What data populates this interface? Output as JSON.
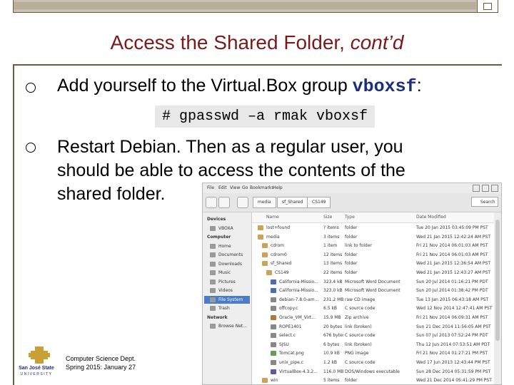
{
  "slide": {
    "title_main": "Access the Shared Folder, ",
    "title_italic": "cont’d",
    "bullet1_text": "Add yourself to the Virtual.Box group ",
    "bullet1_code": "vboxsf",
    "bullet1_colon": ":",
    "command": "# gpasswd –a rmak vboxsf",
    "bullet2_text": "Restart Debian. Then as a regular user, you should be able to access the contents of the shared folder.",
    "footer_line1": "Computer Science Dept.",
    "footer_line2": "Spring 2015: January 27",
    "logo_text": "San José State",
    "logo_sub": "UNIVERSITY"
  },
  "file_manager": {
    "menu": [
      "File",
      "Edit",
      "View",
      "Go",
      "Bookmarks",
      "Help"
    ],
    "breadcrumb": [
      "media",
      "sf_Shared",
      "CS149"
    ],
    "search_label": "Search",
    "columns": {
      "name": "Name",
      "size": "Size",
      "type": "Type",
      "modified": "Date Modified"
    },
    "sidebar": [
      {
        "kind": "head",
        "label": "Devices"
      },
      {
        "kind": "item",
        "label": "VBOXA"
      },
      {
        "kind": "head",
        "label": "Computer"
      },
      {
        "kind": "item",
        "label": "Home"
      },
      {
        "kind": "item",
        "label": "Documents"
      },
      {
        "kind": "item",
        "label": "Downloads"
      },
      {
        "kind": "item",
        "label": "Music"
      },
      {
        "kind": "item",
        "label": "Pictures"
      },
      {
        "kind": "item",
        "label": "Videos"
      },
      {
        "kind": "item",
        "label": "File System",
        "selected": true
      },
      {
        "kind": "item",
        "label": "Trash"
      },
      {
        "kind": "head",
        "label": "Network"
      },
      {
        "kind": "item",
        "label": "Browse Net..."
      }
    ],
    "rows": [
      {
        "name": "lost+found",
        "size": "? items",
        "type": "folder",
        "modified": "Tue 20 Jan 2015 03:45:09 PM PST",
        "color": "#c9a35a",
        "indent": 0
      },
      {
        "name": "media",
        "size": "3 items",
        "type": "folder",
        "modified": "Wed 21 Jan 2015 12:42:24 AM PST",
        "color": "#c9a35a",
        "indent": 0
      },
      {
        "name": "cdrom",
        "size": "1 item",
        "type": "link to folder",
        "modified": "Fri 21 Nov 2014 06:01:03 AM PST",
        "color": "#c9a35a",
        "indent": 1
      },
      {
        "name": "cdrom0",
        "size": "12 items",
        "type": "folder",
        "modified": "Fri 21 Nov 2014 06:01:03 AM PST",
        "color": "#c9a35a",
        "indent": 1
      },
      {
        "name": "sf_Shared",
        "size": "13 items",
        "type": "folder",
        "modified": "Wed 21 Jan 2015 12:36:54 AM PST",
        "color": "#c9a35a",
        "indent": 1
      },
      {
        "name": "CS149",
        "size": "22 items",
        "type": "folder",
        "modified": "Wed 21 Jan 2015 12:43:27 AM PST",
        "color": "#c9a35a",
        "indent": 2
      },
      {
        "name": "California-Missio...",
        "size": "323.4 kB",
        "type": "Microsoft Word Document",
        "modified": "Sun 20 Jul 2014 01:16:21 PM PDT",
        "color": "#4a6fb0",
        "indent": 3
      },
      {
        "name": "California-Missio...",
        "size": "323.0 kB",
        "type": "Microsoft Word Document",
        "modified": "Sun 20 Jul 2014 01:38:42 PM PDT",
        "color": "#4a6fb0",
        "indent": 3
      },
      {
        "name": "debian-7.8.0-am...",
        "size": "231.2 MB",
        "type": "raw CD image",
        "modified": "Tue 13 Jan 2015 06:43:18 AM PST",
        "color": "#888888",
        "indent": 3
      },
      {
        "name": "offcopy.c",
        "size": "6.5 kB",
        "type": "C source code",
        "modified": "Wed 12 Nov 2014 12:47:41 AM PST",
        "color": "#888888",
        "indent": 3
      },
      {
        "name": "Oracle_VM_Virt...",
        "size": "15.9 MB",
        "type": "Zip archive",
        "modified": "Fri 21 Nov 2014 06:09:31 AM PST",
        "color": "#b07a3a",
        "indent": 3
      },
      {
        "name": "ROPE1401",
        "size": "20 bytes",
        "type": "link (broken)",
        "modified": "Sun 21 Dec 2014 11:56:05 AM PST",
        "color": "#888888",
        "indent": 3
      },
      {
        "name": "select.c",
        "size": "676 bytes",
        "type": "C source code",
        "modified": "Sun 07 Jul 2013 07:52:24 PM PDT",
        "color": "#888888",
        "indent": 3
      },
      {
        "name": "SJSU",
        "size": "6 bytes",
        "type": "link (broken)",
        "modified": "Thu 12 Jun 2014 07:53:51 AM PDT",
        "color": "#888888",
        "indent": 3
      },
      {
        "name": "Tomcat.png",
        "size": "10.9 kB",
        "type": "PNG image",
        "modified": "Fri 21 Nov 2014 01:27:21 PM PST",
        "color": "#6a9a5a",
        "indent": 3
      },
      {
        "name": "unix_pipe.c",
        "size": "1.2 kB",
        "type": "C source code",
        "modified": "Wed 17 Jun 2013 12:43:44 PM PST",
        "color": "#888888",
        "indent": 3
      },
      {
        "name": "VirtualBox-4.3.2...",
        "size": "116.0 MB",
        "type": "DOS/Windows executable",
        "modified": "Sun 28 Dec 2014 05:31:59 PM PST",
        "color": "#5a5aa0",
        "indent": 3
      },
      {
        "name": "win",
        "size": "5 items",
        "type": "folder",
        "modified": "Wed 21 Dec 2014 05:41:29 PM PST",
        "color": "#c9a35a",
        "indent": 1
      }
    ]
  }
}
